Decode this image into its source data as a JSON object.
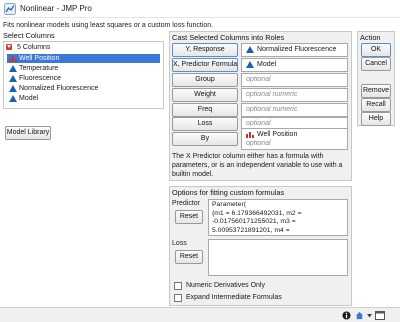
{
  "window": {
    "title": "Nonlinear - JMP Pro",
    "description": "Fits nonlinear models using least squares or a custom loss function."
  },
  "select_columns": {
    "title": "Select Columns",
    "count_label": "5 Columns",
    "items": [
      {
        "label": "Well Position",
        "selected": true,
        "icon": "nominal-icon"
      },
      {
        "label": "Temperature",
        "selected": false,
        "icon": "continuous-icon"
      },
      {
        "label": "Fluorescence",
        "selected": false,
        "icon": "continuous-icon"
      },
      {
        "label": "Normalized Fluorescence",
        "selected": false,
        "icon": "continuous-icon"
      },
      {
        "label": "Model",
        "selected": false,
        "icon": "continuous-icon"
      }
    ],
    "model_library_label": "Model Library"
  },
  "cast_roles": {
    "title": "Cast Selected Columns into Roles",
    "roles": [
      {
        "button": "Y, Response",
        "value": "Normalized Fluorescence",
        "placeholder": ""
      },
      {
        "button": "X, Predictor Formula",
        "value": "Model",
        "placeholder": ""
      },
      {
        "button": "Group",
        "value": "",
        "placeholder": "optional"
      },
      {
        "button": "Weight",
        "value": "",
        "placeholder": "optional numeric"
      },
      {
        "button": "Freq",
        "value": "",
        "placeholder": "optional numeric"
      },
      {
        "button": "Loss",
        "value": "",
        "placeholder": "optional"
      },
      {
        "button": "By",
        "value": "Well Position",
        "placeholder": "optional"
      }
    ],
    "note": "The X Predictor column either has a formula with parameters, or is an independent variable to use with a builtin model."
  },
  "action": {
    "title": "Action",
    "buttons": [
      "OK",
      "Cancel",
      "Remove",
      "Recall",
      "Help"
    ]
  },
  "custom_formulas": {
    "title": "Options for fitting custom formulas",
    "predictor_label": "Predictor",
    "reset_label": "Reset",
    "predictor_formula": "Parameter(\n{m1 = 6.179366492031, m2 = -0.017560171255021, m3 = 5.00953721891201, m4 =",
    "loss_label": "Loss",
    "loss_reset_label": "Reset",
    "options": [
      {
        "label": "Numeric Derivatives Only",
        "checked": false
      },
      {
        "label": "Expand Intermediate Formulas",
        "checked": false
      }
    ]
  },
  "colors": {
    "selection": "#3b78d8",
    "panel_bg": "#f0f0f0",
    "nominal_icon": "#c0392b",
    "continuous_icon": "#1f5fb4"
  }
}
